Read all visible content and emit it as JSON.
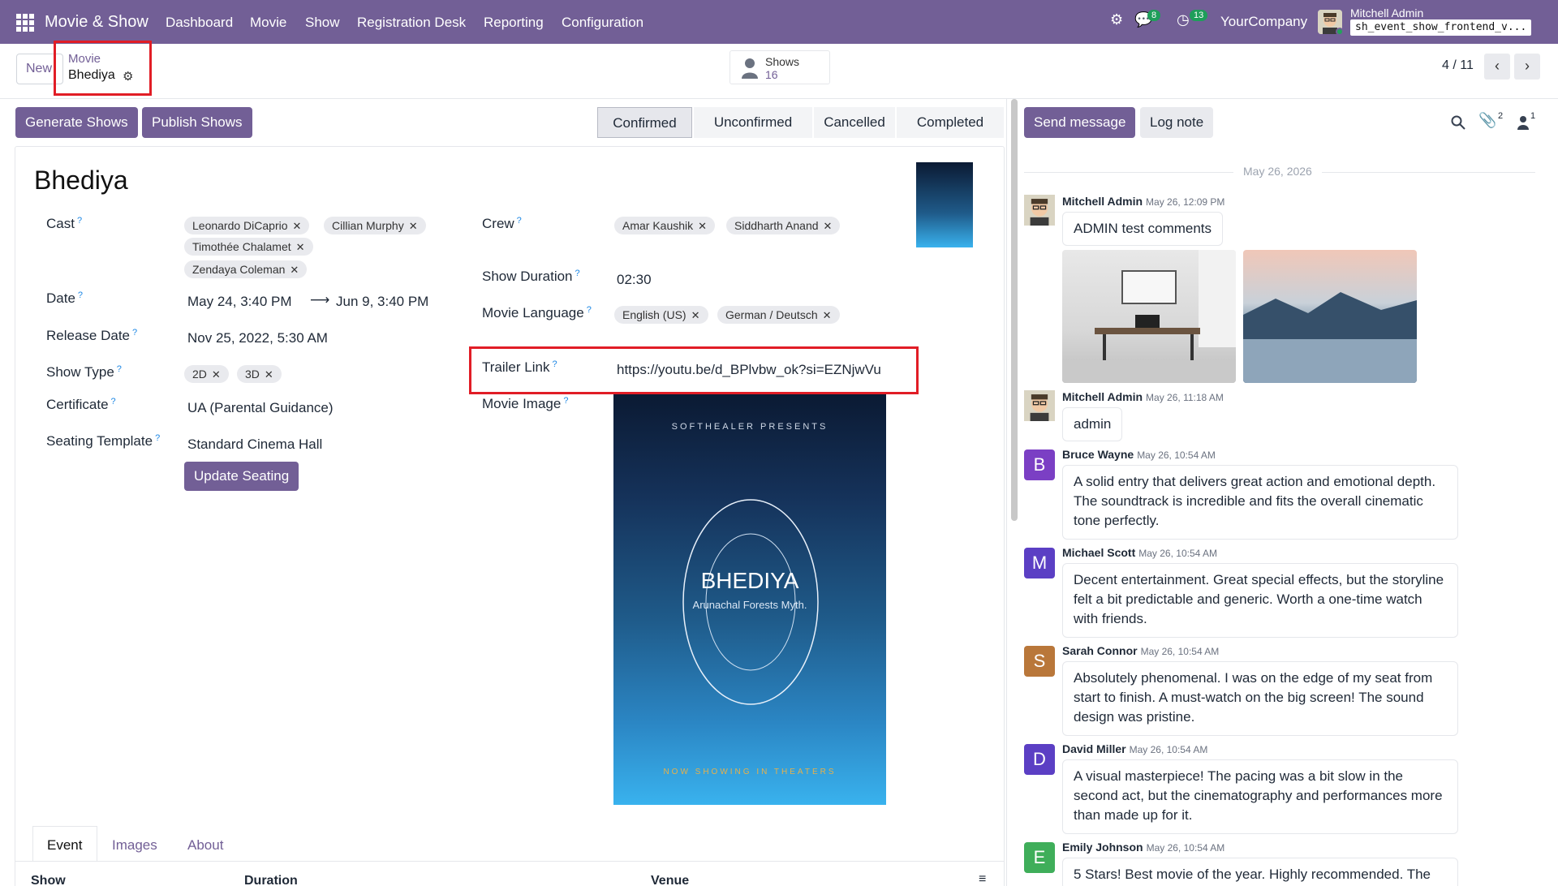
{
  "navbar": {
    "brand": "Movie & Show",
    "menu": [
      "Dashboard",
      "Movie",
      "Show",
      "Registration Desk",
      "Reporting",
      "Configuration"
    ],
    "messages_count": "8",
    "activities_count": "13",
    "company": "YourCompany",
    "user_name": "Mitchell Admin",
    "database": "sh_event_show_frontend_v..."
  },
  "control": {
    "new_label": "New",
    "breadcrumb_parent": "Movie",
    "breadcrumb_current": "Bhediya",
    "smart_button_label": "Shows",
    "smart_button_count": "16",
    "pager": "4 / 11"
  },
  "actions": {
    "generate": "Generate Shows",
    "publish": "Publish Shows"
  },
  "statusbar": [
    "Confirmed",
    "Unconfirmed",
    "Cancelled",
    "Completed"
  ],
  "form": {
    "title": "Bhediya",
    "cast_label": "Cast",
    "cast": [
      "Leonardo DiCaprio",
      "Cillian Murphy",
      "Timothée Chalamet",
      "Zendaya Coleman"
    ],
    "date_label": "Date",
    "date_start": "May 24, 3:40 PM",
    "date_arrow": "⟶",
    "date_end": "Jun 9, 3:40 PM",
    "release_label": "Release Date",
    "release_value": "Nov 25, 2022, 5:30 AM",
    "show_type_label": "Show Type",
    "show_types": [
      "2D",
      "3D"
    ],
    "certificate_label": "Certificate",
    "certificate_value": "UA (Parental Guidance)",
    "seating_label": "Seating Template",
    "seating_value": "Standard Cinema Hall",
    "update_seating": "Update Seating",
    "crew_label": "Crew",
    "crew": [
      "Amar Kaushik",
      "Siddharth Anand"
    ],
    "duration_label": "Show Duration",
    "duration_value": "02:30",
    "language_label": "Movie Language",
    "languages": [
      "English (US)",
      "German / Deutsch"
    ],
    "trailer_label": "Trailer Link",
    "trailer_value": "https://youtu.be/d_BPlvbw_ok?si=EZNjwVu",
    "image_label": "Movie Image",
    "help_mark": "?"
  },
  "poster": {
    "presents": "SOFTHEALER PRESENTS",
    "title": "BHEDIYA",
    "subtitle": "Arunachal Forests Myth.",
    "footer": "NOW SHOWING IN THEATERS"
  },
  "tabs": [
    "Event",
    "Images",
    "About"
  ],
  "table_headers": [
    "Show",
    "Duration",
    "Venue"
  ],
  "chatter": {
    "send_message": "Send message",
    "log_note": "Log note",
    "attachments_count": "2",
    "followers_count": "1",
    "date_separator": "May 26, 2026",
    "messages": [
      {
        "initial": "",
        "author": "Mitchell Admin",
        "date": "May 26, 12:09 PM",
        "body": "ADMIN test comments",
        "color": "#d9d4c2"
      },
      {
        "initial": "",
        "author": "Mitchell Admin",
        "date": "May 26, 11:18 AM",
        "body": "admin",
        "color": "#d9d4c2"
      },
      {
        "initial": "B",
        "author": "Bruce Wayne",
        "date": "May 26, 10:54 AM",
        "body": "A solid entry that delivers great action and emotional depth. The soundtrack is incredible and fits the overall cinematic tone perfectly.",
        "color": "#7b3fc4"
      },
      {
        "initial": "M",
        "author": "Michael Scott",
        "date": "May 26, 10:54 AM",
        "body": "Decent entertainment. Great special effects, but the storyline felt a bit predictable and generic. Worth a one-time watch with friends.",
        "color": "#5b3fc4"
      },
      {
        "initial": "S",
        "author": "Sarah Connor",
        "date": "May 26, 10:54 AM",
        "body": "Absolutely phenomenal. I was on the edge of my seat from start to finish. A must-watch on the big screen! The sound design was pristine.",
        "color": "#b9773a"
      },
      {
        "initial": "D",
        "author": "David Miller",
        "date": "May 26, 10:54 AM",
        "body": "A visual masterpiece! The pacing was a bit slow in the second act, but the cinematography and performances more than made up for it.",
        "color": "#5b3fc4"
      },
      {
        "initial": "E",
        "author": "Emily Johnson",
        "date": "May 26, 10:54 AM",
        "body": "5 Stars! Best movie of the year. Highly recommended. The",
        "color": "#3fae5a"
      }
    ]
  }
}
